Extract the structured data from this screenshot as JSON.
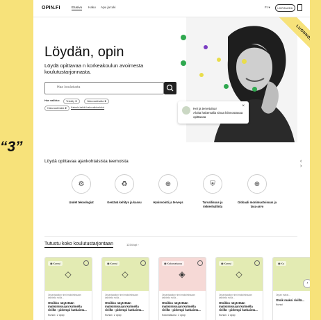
{
  "header": {
    "logo": "OPIN.FI",
    "nav": [
      "Etusivu",
      "Haku",
      "Apu ja tuki"
    ],
    "lang": "FI ▾",
    "login": "LKIRJAUDU",
    "ribbon": "LUONNOS"
  },
  "hero": {
    "title": "Löydän, opin",
    "lede": "Löydä opittavaa n korkeakoulun avoimesta koulutustarjonnasta.",
    "search_placeholder": "Hae koulutusta",
    "filters_label": "Hae valikko:",
    "filter_chips": [
      "Tekoäly ✚",
      "Hakuvaatimatta ✚",
      "Hakuvaatimatta ✚"
    ],
    "filters_link": "Katselu kaikki hakuvaihtoehdot"
  },
  "chat": {
    "line1": "Hei ja tervetuloa!",
    "line2": "Aloita hakemalla sinua kiinnostavaa opittavaa",
    "close": "×"
  },
  "quote": "“3”",
  "themes_section": {
    "title": "Löydä opittavaa ajankohtaisista teemoista",
    "arrows": "‹ ›",
    "items": [
      {
        "label": "Uudet teknologiat",
        "icon": "technology-icon",
        "glyph": "⚙"
      },
      {
        "label": "Kestävä kehitys ja kasvu",
        "icon": "growth-icon",
        "glyph": "♻"
      },
      {
        "label": "Hyvinvointi ja terveys",
        "icon": "health-icon",
        "glyph": "⊕"
      },
      {
        "label": "Turvallisuus ja riskienhallinta",
        "icon": "shield-icon",
        "glyph": "⛨"
      },
      {
        "label": "Globaali monimuotoisuus ja tasa-arvo",
        "icon": "globe-icon",
        "glyph": "⊕"
      }
    ]
  },
  "courses_section": {
    "title": "Tutustu koko koulutustarjontaan",
    "count": "1234 kpl ›",
    "next": "›",
    "cards": [
      {
        "badge": "◉ Kurssi",
        "org": "Organisaation nimi maksimissaan kahdella rivillä...",
        "title": "Otsikko näytetään maksimissaan kolmella rivillä - pidempi katkaista...",
        "meta": "Kurssi • 2 opop",
        "color": "#e3ebb3"
      },
      {
        "badge": "◉ Kurssi",
        "org": "Organisaation nimi maksimissaan kahdella rivillä...",
        "title": "Otsikko näytetään maksimissaan kolmella rivillä - pidempi katkaista...",
        "meta": "Kurssi • 2 opop",
        "color": "#e3ebb3"
      },
      {
        "badge": "◉ Kokonaisuus",
        "org": "Organisaation nimi maksimissaan kahdella rivillä...",
        "title": "Otsikko näytetään maksimissaan kolmella rivillä - pidempi katkaista...",
        "meta": "Kokonaisuus • 2 opop",
        "color": "#f6d9d6"
      },
      {
        "badge": "◉ Kurssi",
        "org": "Organisaation nimi maksimissaan kahdella rivillä...",
        "title": "Otsikko näytetään maksimissaan kolmella rivillä - pidempi katkaista...",
        "meta": "Kurssi • 2 opop",
        "color": "#e3ebb3"
      },
      {
        "badge": "◉ Ku",
        "org": "Organ maksi...",
        "title": "Otsik maksi rivillä...",
        "meta": "Kurssi",
        "color": "#e3ebb3"
      }
    ]
  },
  "colors": {
    "background": "#f7e27a",
    "card_green": "#e3ebb3",
    "card_pink": "#f6d9d6",
    "dot_green": "#2fa84f",
    "dot_yellow": "#e9dd4a",
    "dot_purple": "#7a3cc2"
  }
}
